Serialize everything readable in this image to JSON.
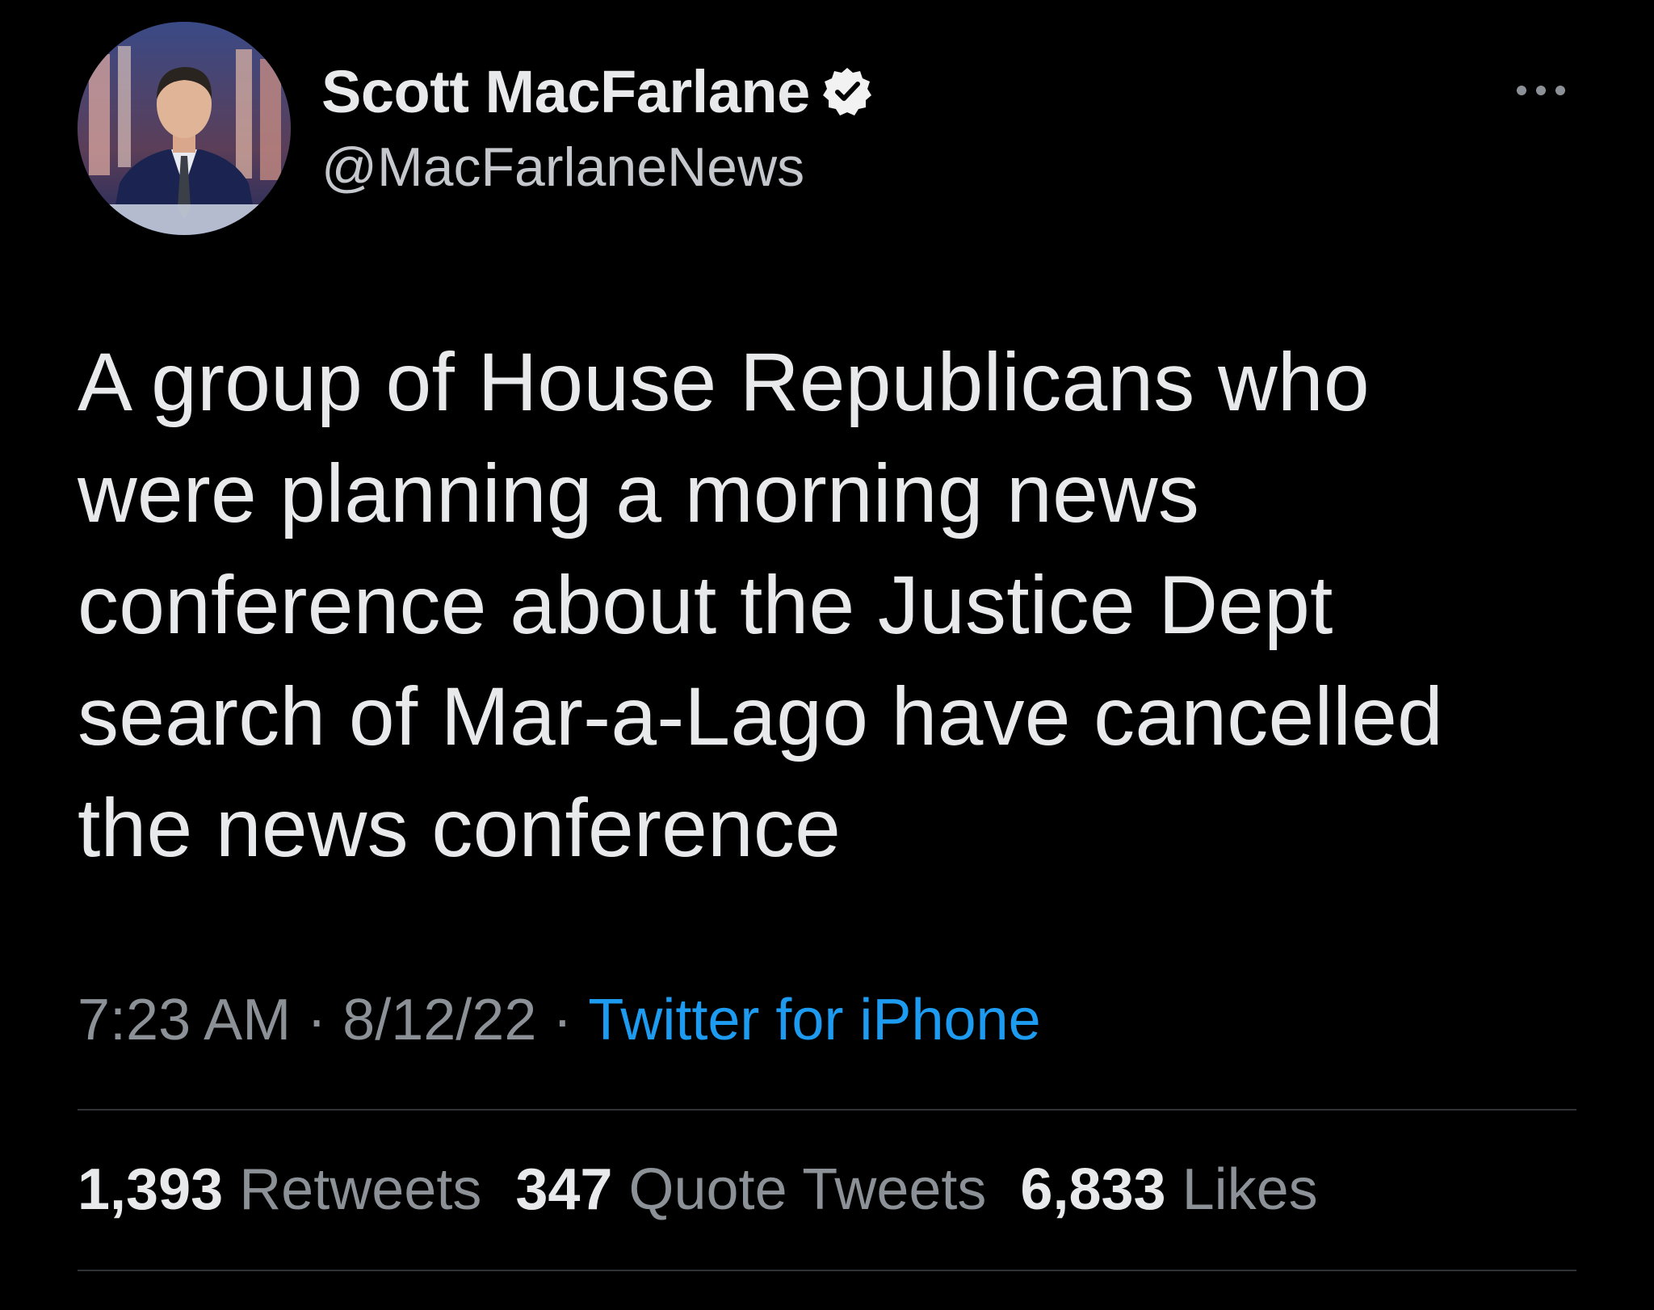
{
  "author": {
    "display_name": "Scott MacFarlane",
    "handle": "@MacFarlaneNews",
    "verified": true,
    "avatar_icon": "profile-photo"
  },
  "tweet": {
    "text": "A group of House Republicans who\nwere planning a morning news\nconference about the Justice Dept\nsearch of Mar-a-Lago have cancelled\nthe news conference",
    "time": "7:23 AM",
    "date": "8/12/22",
    "separator": "·",
    "source": "Twitter for iPhone"
  },
  "stats": {
    "retweets_count": "1,393",
    "retweets_label": "Retweets",
    "quote_count": "347",
    "quote_label": "Quote Tweets",
    "likes_count": "6,833",
    "likes_label": "Likes"
  },
  "icons": {
    "more": "more-options-icon",
    "verified": "verified-badge-icon"
  },
  "colors": {
    "background": "#000000",
    "text_primary": "#e7e9ea",
    "text_secondary": "#8b9196",
    "link": "#1d9bf0",
    "divider": "#2f3336"
  }
}
